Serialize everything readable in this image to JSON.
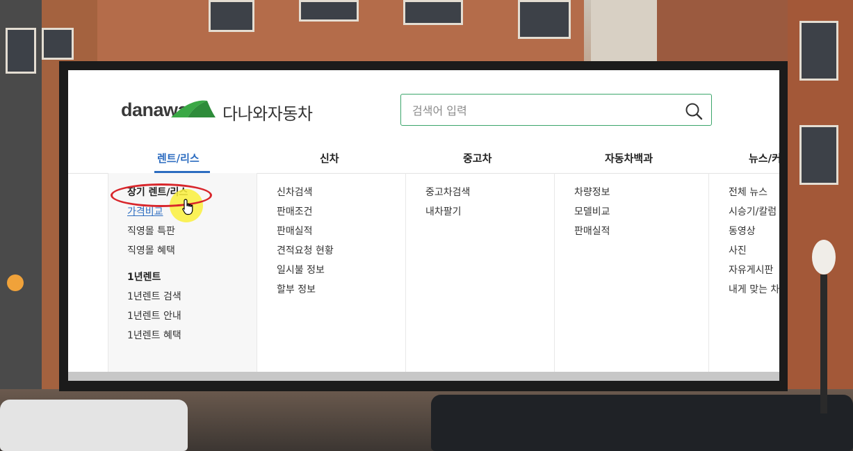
{
  "logo": {
    "wordmark": "danawa",
    "name_kr": "다나와자동차"
  },
  "search": {
    "placeholder": "검색어 입력",
    "value": ""
  },
  "nav": {
    "tabs": [
      {
        "label": "렌트/리스",
        "active": true
      },
      {
        "label": "신차",
        "active": false
      },
      {
        "label": "중고차",
        "active": false
      },
      {
        "label": "자동차백과",
        "active": false
      },
      {
        "label": "뉴스/커",
        "active": false
      }
    ]
  },
  "menu": {
    "rent": {
      "section1_title": "장기 렌트/리스",
      "section1_items": [
        "가격비교",
        "직영몰 특판",
        "직영몰 혜택"
      ],
      "section2_title": "1년렌트",
      "section2_items": [
        "1년렌트 검색",
        "1년렌트 안내",
        "1년렌트 혜택"
      ]
    },
    "newcar": [
      "신차검색",
      "판매조건",
      "판매실적",
      "견적요청 현황",
      "일시불 정보",
      "할부 정보"
    ],
    "usedcar": [
      "중고차검색",
      "내차팔기"
    ],
    "encyclopedia": [
      "차량정보",
      "모델비교",
      "판매실적"
    ],
    "news": [
      "전체 뉴스",
      "시승기/칼럼",
      "동영상",
      "사진",
      "자유게시판",
      "내게 맞는 차"
    ]
  },
  "colors": {
    "accent_blue": "#2c6cc0",
    "search_border": "#3aa56a",
    "logo_green": "#3aa845",
    "annotation_red": "#d8262b",
    "cursor_highlight": "#faf03c"
  }
}
